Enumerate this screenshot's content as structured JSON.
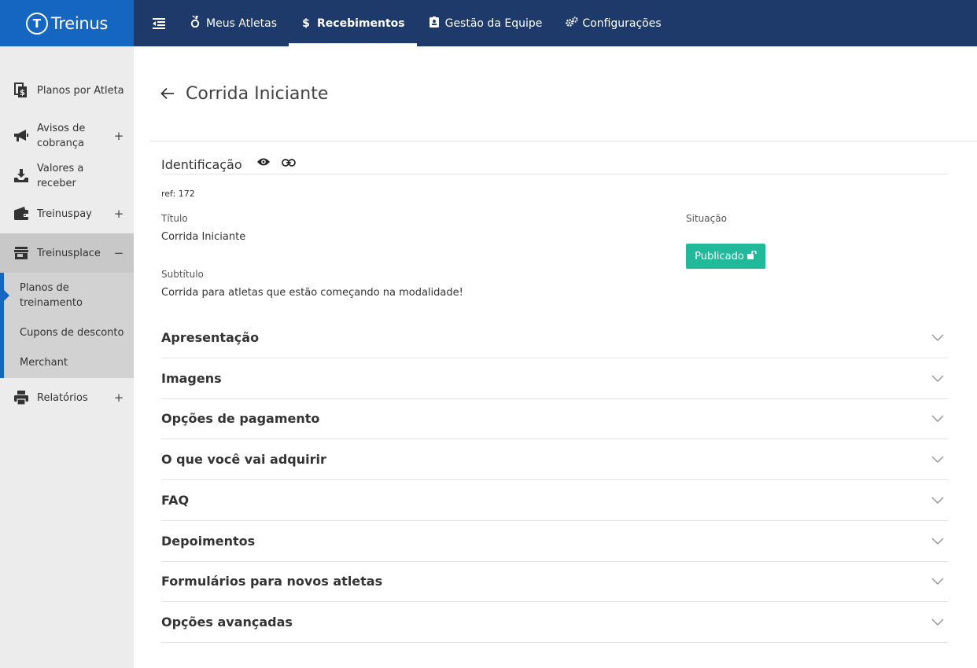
{
  "app": {
    "logo_text": "Treinus"
  },
  "topnav": {
    "items": [
      {
        "label": "Meus Atletas",
        "icon": "medal-icon",
        "active": false
      },
      {
        "label": "Recebimentos",
        "icon": "dollar-icon",
        "active": true
      },
      {
        "label": "Gestão da Equipe",
        "icon": "id-badge-icon",
        "active": false
      },
      {
        "label": "Configurações",
        "icon": "gears-icon",
        "active": false
      }
    ]
  },
  "sidebar": {
    "items": [
      {
        "label": "Planos por Atleta",
        "icon": "file-dollar-icon"
      },
      {
        "label": "Avisos de cobrança",
        "icon": "megaphone-icon",
        "expandable": "+"
      },
      {
        "label": "Valores a receber",
        "icon": "inbox-download-icon"
      },
      {
        "label": "Treinuspay",
        "icon": "wallet-icon",
        "expandable": "+"
      },
      {
        "label": "Treinusplace",
        "icon": "store-icon",
        "expandable": "−"
      },
      {
        "label": "Relatórios",
        "icon": "printer-icon",
        "expandable": "+"
      }
    ],
    "subitems": [
      {
        "label": "Planos de treinamento",
        "active": true
      },
      {
        "label": "Cupons de desconto",
        "active": false
      },
      {
        "label": "Merchant",
        "active": false
      }
    ]
  },
  "page": {
    "title": "Corrida Iniciante"
  },
  "identification": {
    "heading": "Identificação",
    "ref": "ref: 172",
    "title_label": "Título",
    "title_value": "Corrida Iniciante",
    "status_label": "Situação",
    "status_button": "Publicado",
    "subtitle_label": "Subtítulo",
    "subtitle_value": "Corrida para atletas que estão começando na modalidade!"
  },
  "sections": [
    "Apresentação",
    "Imagens",
    "Opções de pagamento",
    "O que você vai adquirir",
    "FAQ",
    "Depoimentos",
    "Formulários para novos atletas",
    "Opções avançadas"
  ],
  "colors": {
    "topbar": "#1e3a6b",
    "logo_bg": "#1466c0",
    "accent": "#1466c0",
    "status_published": "#22b89a",
    "sidebar_bg": "#ececec"
  }
}
